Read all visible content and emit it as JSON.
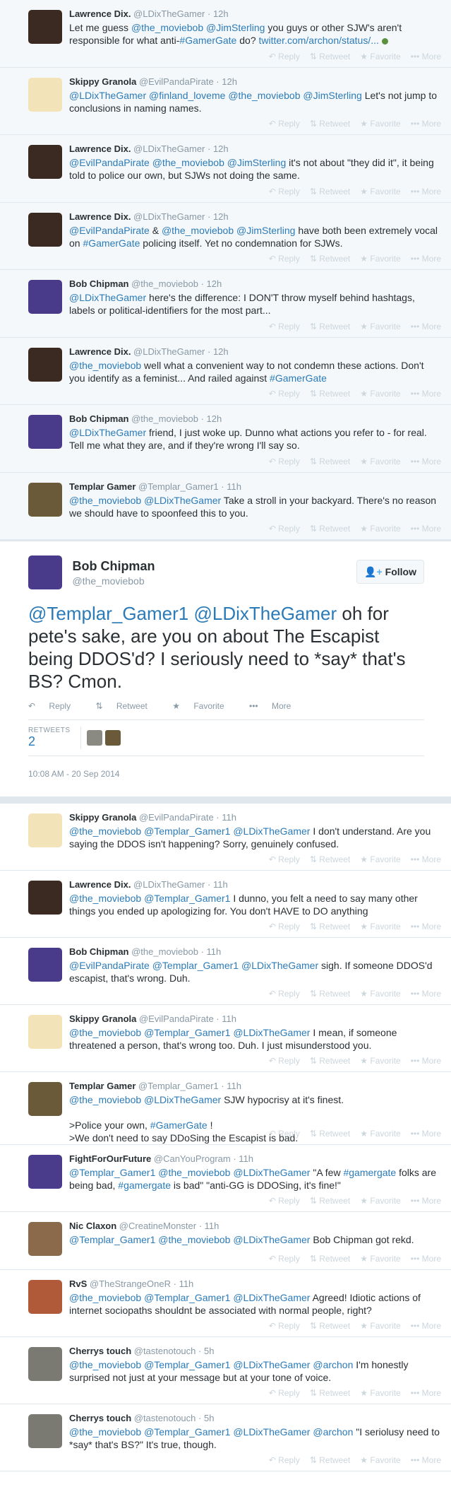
{
  "actions": {
    "reply": "Reply",
    "retweet": "Retweet",
    "favorite": "Favorite",
    "more": "More"
  },
  "ancestors": [
    {
      "name": "Lawrence Dix.",
      "handle": "@LDixTheGamer",
      "time": "12h",
      "avatar": "#3a2a22",
      "segments": [
        [
          "t",
          "Let me guess "
        ],
        [
          "m",
          "@the_moviebob"
        ],
        [
          "t",
          " "
        ],
        [
          "m",
          "@JimSterling"
        ],
        [
          "t",
          " you guys or other SJW's aren't responsible for what anti-"
        ],
        [
          "h",
          "#GamerGate"
        ],
        [
          "t",
          " do?  "
        ],
        [
          "l",
          "twitter.com/archon/status/..."
        ]
      ],
      "dot": true
    },
    {
      "name": "Skippy Granola",
      "handle": "@EvilPandaPirate",
      "time": "12h",
      "avatar": "#f3e3b8",
      "segments": [
        [
          "m",
          "@LDixTheGamer"
        ],
        [
          "t",
          " "
        ],
        [
          "m",
          "@finland_loveme"
        ],
        [
          "t",
          " "
        ],
        [
          "m",
          "@the_moviebob"
        ],
        [
          "t",
          " "
        ],
        [
          "m",
          "@JimSterling"
        ],
        [
          "t",
          " Let's not jump to conclusions in naming names."
        ]
      ]
    },
    {
      "name": "Lawrence Dix.",
      "handle": "@LDixTheGamer",
      "time": "12h",
      "avatar": "#3a2a22",
      "segments": [
        [
          "m",
          "@EvilPandaPirate"
        ],
        [
          "t",
          " "
        ],
        [
          "m",
          "@the_moviebob"
        ],
        [
          "t",
          " "
        ],
        [
          "m",
          "@JimSterling"
        ],
        [
          "t",
          " it's not about \"they did it\", it being told to police our own, but SJWs not doing the same."
        ]
      ]
    },
    {
      "name": "Lawrence Dix.",
      "handle": "@LDixTheGamer",
      "time": "12h",
      "avatar": "#3a2a22",
      "segments": [
        [
          "m",
          "@EvilPandaPirate"
        ],
        [
          "t",
          " & "
        ],
        [
          "m",
          "@the_moviebob"
        ],
        [
          "t",
          " "
        ],
        [
          "m",
          "@JimSterling"
        ],
        [
          "t",
          " have both been extremely vocal on "
        ],
        [
          "h",
          "#GamerGate"
        ],
        [
          "t",
          " policing itself. Yet no condemnation for SJWs."
        ]
      ]
    },
    {
      "name": "Bob Chipman",
      "handle": "@the_moviebob",
      "time": "12h",
      "avatar": "#4a3a8a",
      "segments": [
        [
          "m",
          "@LDixTheGamer"
        ],
        [
          "t",
          " here's the difference: I DON'T throw myself behind hashtags, labels or political-identifiers for the most part..."
        ]
      ]
    },
    {
      "name": "Lawrence Dix.",
      "handle": "@LDixTheGamer",
      "time": "12h",
      "avatar": "#3a2a22",
      "segments": [
        [
          "m",
          "@the_moviebob"
        ],
        [
          "t",
          " well what a convenient way to not condemn these actions. Don't you identify as a feminist... And railed against "
        ],
        [
          "h",
          "#GamerGate"
        ]
      ]
    },
    {
      "name": "Bob Chipman",
      "handle": "@the_moviebob",
      "time": "12h",
      "avatar": "#4a3a8a",
      "segments": [
        [
          "m",
          "@LDixTheGamer"
        ],
        [
          "t",
          " friend, I just woke up. Dunno what actions you refer to - for real. Tell me what they are, and if they're wrong I'll say so."
        ]
      ]
    },
    {
      "name": "Templar Gamer",
      "handle": "@Templar_Gamer1",
      "time": "11h",
      "avatar": "#6b5a3a",
      "segments": [
        [
          "m",
          "@the_moviebob"
        ],
        [
          "t",
          " "
        ],
        [
          "m",
          "@LDixTheGamer"
        ],
        [
          "t",
          " Take a stroll in your backyard. There's no reason we should have to spoonfeed this to you."
        ]
      ]
    }
  ],
  "main": {
    "name": "Bob Chipman",
    "handle": "@the_moviebob",
    "avatar": "#4a3a8a",
    "follow": "Follow",
    "segments": [
      [
        "m",
        "@Templar_Gamer1"
      ],
      [
        "t",
        " "
      ],
      [
        "m",
        "@LDixTheGamer"
      ],
      [
        "t",
        " oh for pete's sake, are you on about The Escapist being DDOS'd? I seriously need to *say* that's BS? Cmon."
      ]
    ],
    "retweets_label": "RETWEETS",
    "retweets_value": "2",
    "timestamp": "10:08 AM - 20 Sep 2014"
  },
  "replies": [
    {
      "name": "Skippy Granola",
      "handle": "@EvilPandaPirate",
      "time": "11h",
      "avatar": "#f3e3b8",
      "segments": [
        [
          "m",
          "@the_moviebob"
        ],
        [
          "t",
          " "
        ],
        [
          "m",
          "@Templar_Gamer1"
        ],
        [
          "t",
          " "
        ],
        [
          "m",
          "@LDixTheGamer"
        ],
        [
          "t",
          " I don't understand. Are you saying the DDOS isn't happening? Sorry, genuinely confused."
        ]
      ]
    },
    {
      "name": "Lawrence Dix.",
      "handle": "@LDixTheGamer",
      "time": "11h",
      "avatar": "#3a2a22",
      "segments": [
        [
          "m",
          "@the_moviebob"
        ],
        [
          "t",
          " "
        ],
        [
          "m",
          "@Templar_Gamer1"
        ],
        [
          "t",
          " I dunno, you felt a need to say many other things you ended up apologizing for. You don't HAVE to DO anything"
        ]
      ]
    },
    {
      "name": "Bob Chipman",
      "handle": "@the_moviebob",
      "time": "11h",
      "avatar": "#4a3a8a",
      "segments": [
        [
          "m",
          "@EvilPandaPirate"
        ],
        [
          "t",
          " "
        ],
        [
          "m",
          "@Templar_Gamer1"
        ],
        [
          "t",
          " "
        ],
        [
          "m",
          "@LDixTheGamer"
        ],
        [
          "t",
          " sigh. If someone DDOS'd escapist, that's wrong. Duh."
        ]
      ]
    },
    {
      "name": "Skippy Granola",
      "handle": "@EvilPandaPirate",
      "time": "11h",
      "avatar": "#f3e3b8",
      "segments": [
        [
          "m",
          "@the_moviebob"
        ],
        [
          "t",
          " "
        ],
        [
          "m",
          "@Templar_Gamer1"
        ],
        [
          "t",
          " "
        ],
        [
          "m",
          "@LDixTheGamer"
        ],
        [
          "t",
          " I mean, if someone threatened a person, that's wrong too. Duh. I just misunderstood you."
        ]
      ]
    },
    {
      "name": "Templar Gamer",
      "handle": "@Templar_Gamer1",
      "time": "11h",
      "avatar": "#6b5a3a",
      "segments": [
        [
          "m",
          "@the_moviebob"
        ],
        [
          "t",
          " "
        ],
        [
          "m",
          "@LDixTheGamer"
        ],
        [
          "t",
          " SJW hypocrisy at it's finest."
        ],
        [
          "br",
          ""
        ],
        [
          "br",
          ""
        ],
        [
          "t",
          ">Police your own, "
        ],
        [
          "h",
          "#GamerGate"
        ],
        [
          "t",
          " !"
        ],
        [
          "br",
          ""
        ],
        [
          "t",
          ">We don't need to say DDoSing the Escapist is bad."
        ]
      ],
      "tall": true
    },
    {
      "name": "FightForOurFuture",
      "handle": "@CanYouProgram",
      "time": "11h",
      "avatar": "#4b3b8b",
      "segments": [
        [
          "m",
          "@Templar_Gamer1"
        ],
        [
          "t",
          " "
        ],
        [
          "m",
          "@the_moviebob"
        ],
        [
          "t",
          " "
        ],
        [
          "m",
          "@LDixTheGamer"
        ],
        [
          "t",
          " \"A few "
        ],
        [
          "h",
          "#gamergate"
        ],
        [
          "t",
          " folks are being bad, "
        ],
        [
          "h",
          "#gamergate"
        ],
        [
          "t",
          " is bad\" \"anti-GG is DDOSing, it's fine!\""
        ]
      ]
    },
    {
      "name": "Nic Claxon",
      "handle": "@CreatineMonster",
      "time": "11h",
      "avatar": "#8a6a4a",
      "segments": [
        [
          "m",
          "@Templar_Gamer1"
        ],
        [
          "t",
          " "
        ],
        [
          "m",
          "@the_moviebob"
        ],
        [
          "t",
          " "
        ],
        [
          "m",
          "@LDixTheGamer"
        ],
        [
          "t",
          " Bob Chipman got rekd."
        ]
      ],
      "short": true
    },
    {
      "name": "RvS",
      "handle": "@TheStrangeOneR",
      "time": "11h",
      "avatar": "#b05a3a",
      "segments": [
        [
          "m",
          "@the_moviebob"
        ],
        [
          "t",
          " "
        ],
        [
          "m",
          "@Templar_Gamer1"
        ],
        [
          "t",
          " "
        ],
        [
          "m",
          "@LDixTheGamer"
        ],
        [
          "t",
          " Agreed! Idiotic actions of internet sociopaths shouldnt be associated with normal people, right?"
        ]
      ]
    },
    {
      "name": "Cherrys touch",
      "handle": "@tastenotouch",
      "time": "5h",
      "avatar": "#7a7a72",
      "segments": [
        [
          "m",
          "@the_moviebob"
        ],
        [
          "t",
          " "
        ],
        [
          "m",
          "@Templar_Gamer1"
        ],
        [
          "t",
          " "
        ],
        [
          "m",
          "@LDixTheGamer"
        ],
        [
          "t",
          " "
        ],
        [
          "m",
          "@archon"
        ],
        [
          "t",
          " I'm honestly surprised not just at your message but at your tone of voice."
        ]
      ]
    },
    {
      "name": "Cherrys touch",
      "handle": "@tastenotouch",
      "time": "5h",
      "avatar": "#7a7a72",
      "segments": [
        [
          "m",
          "@the_moviebob"
        ],
        [
          "t",
          " "
        ],
        [
          "m",
          "@Templar_Gamer1"
        ],
        [
          "t",
          " "
        ],
        [
          "m",
          "@LDixTheGamer"
        ],
        [
          "t",
          " "
        ],
        [
          "m",
          "@archon"
        ],
        [
          "t",
          " \"I seriolusy need to *say* that's BS?\" It's true, though."
        ]
      ]
    }
  ]
}
